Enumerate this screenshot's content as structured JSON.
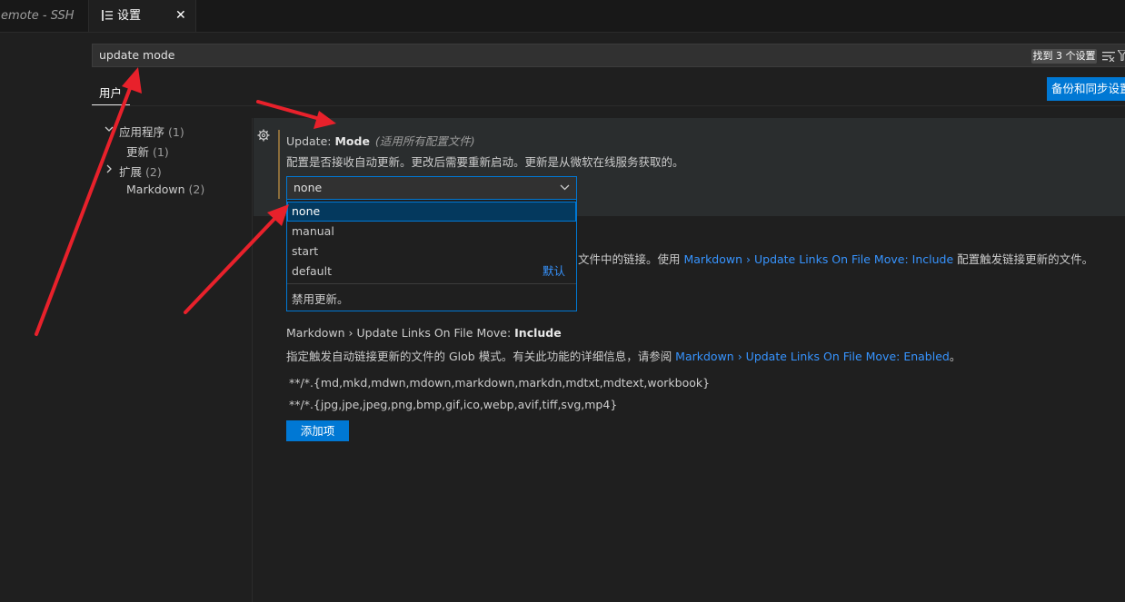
{
  "tabs": {
    "remote_label": "Remote - SSH",
    "settings_label": "设置",
    "close_glyph": "✕"
  },
  "search": {
    "value": "update mode",
    "result_count": "找到 3 个设置"
  },
  "scope": {
    "user_tab": "用户",
    "backup_button": "备份和同步设置"
  },
  "tree": {
    "app": {
      "label": "应用程序",
      "count": "(1)"
    },
    "update": {
      "label": "更新",
      "count": "(1)"
    },
    "extensions": {
      "label": "扩展",
      "count": "(2)"
    },
    "markdown": {
      "label": "Markdown",
      "count": "(2)"
    }
  },
  "update_mode": {
    "prefix": "Update: ",
    "name": "Mode",
    "scope_note": "(适用所有配置文件)",
    "description": "配置是否接收自动更新。更改后需要重新启动。更新是从微软在线服务获取的。",
    "selected": "none",
    "options": [
      "none",
      "manual",
      "start",
      "default"
    ],
    "default_tag": "默认",
    "option_description": "禁用更新。"
  },
  "links_enabled": {
    "text_a": "文件中的链接。使用 ",
    "link": "Markdown › Update Links On File Move: Include",
    "text_b": " 配置触发链接更新的文件。"
  },
  "links_include": {
    "prefix": "Markdown › Update Links On File Move: ",
    "name": "Include",
    "desc_a": "指定触发自动链接更新的文件的 Glob 模式。有关此功能的详细信息，请参阅 ",
    "desc_link": "Markdown › Update Links On File Move: Enabled",
    "desc_b": "。",
    "globs": [
      "**/*.{md,mkd,mdwn,mdown,markdown,markdn,mdtxt,mdtext,workbook}",
      "**/*.{jpg,jpe,jpeg,png,bmp,gif,ico,webp,avif,tiff,svg,mp4}"
    ],
    "add_button": "添加项"
  },
  "colors": {
    "accent": "#0078d4",
    "link": "#3794ff",
    "annotation_arrow": "#e8212b"
  }
}
